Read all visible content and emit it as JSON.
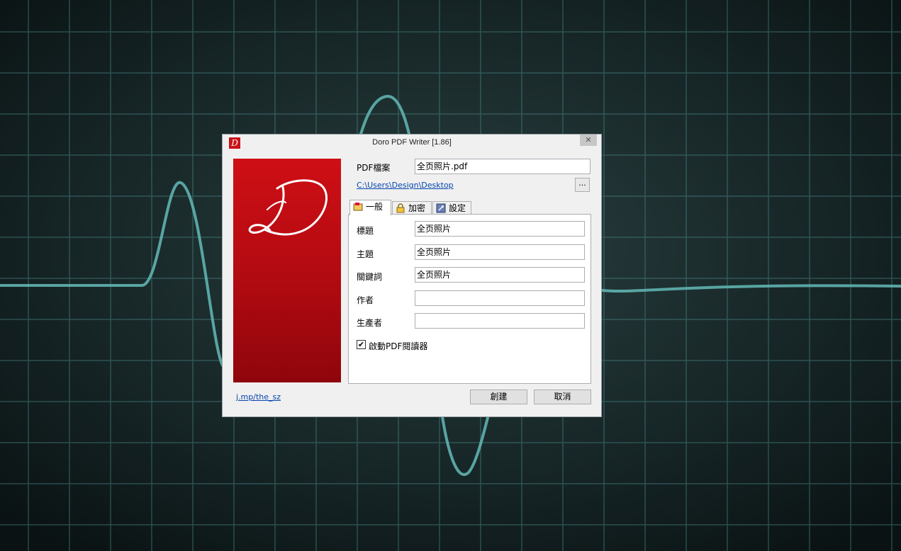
{
  "window": {
    "title": "Doro PDF Writer [1.86]",
    "close_glyph": "✕",
    "icon_letter": "D"
  },
  "file": {
    "label": "PDF檔案",
    "value": "全页照片.pdf",
    "path": "C:\\Users\\Design\\Desktop",
    "browse_label": "..."
  },
  "tabs": [
    {
      "label": "一般",
      "icon": "general-icon",
      "active": true
    },
    {
      "label": "加密",
      "icon": "lock-icon",
      "active": false
    },
    {
      "label": "設定",
      "icon": "settings-icon",
      "active": false
    }
  ],
  "general": {
    "fields": [
      {
        "label": "標題",
        "value": "全页照片"
      },
      {
        "label": "主題",
        "value": "全页照片"
      },
      {
        "label": "關鍵詞",
        "value": "全页照片"
      },
      {
        "label": "作者",
        "value": ""
      },
      {
        "label": "生產者",
        "value": ""
      }
    ],
    "open_viewer": {
      "label": "啟動PDF閱讀器",
      "checked": true
    }
  },
  "footer": {
    "link": "j.mp/the_sz",
    "create_label": "創建",
    "cancel_label": "取消"
  },
  "colors": {
    "banner_red": "#c8141a",
    "desktop_bg": "#0f1c1d",
    "grid_line": "#4d8c8c",
    "wave": "#5fb3b0"
  }
}
